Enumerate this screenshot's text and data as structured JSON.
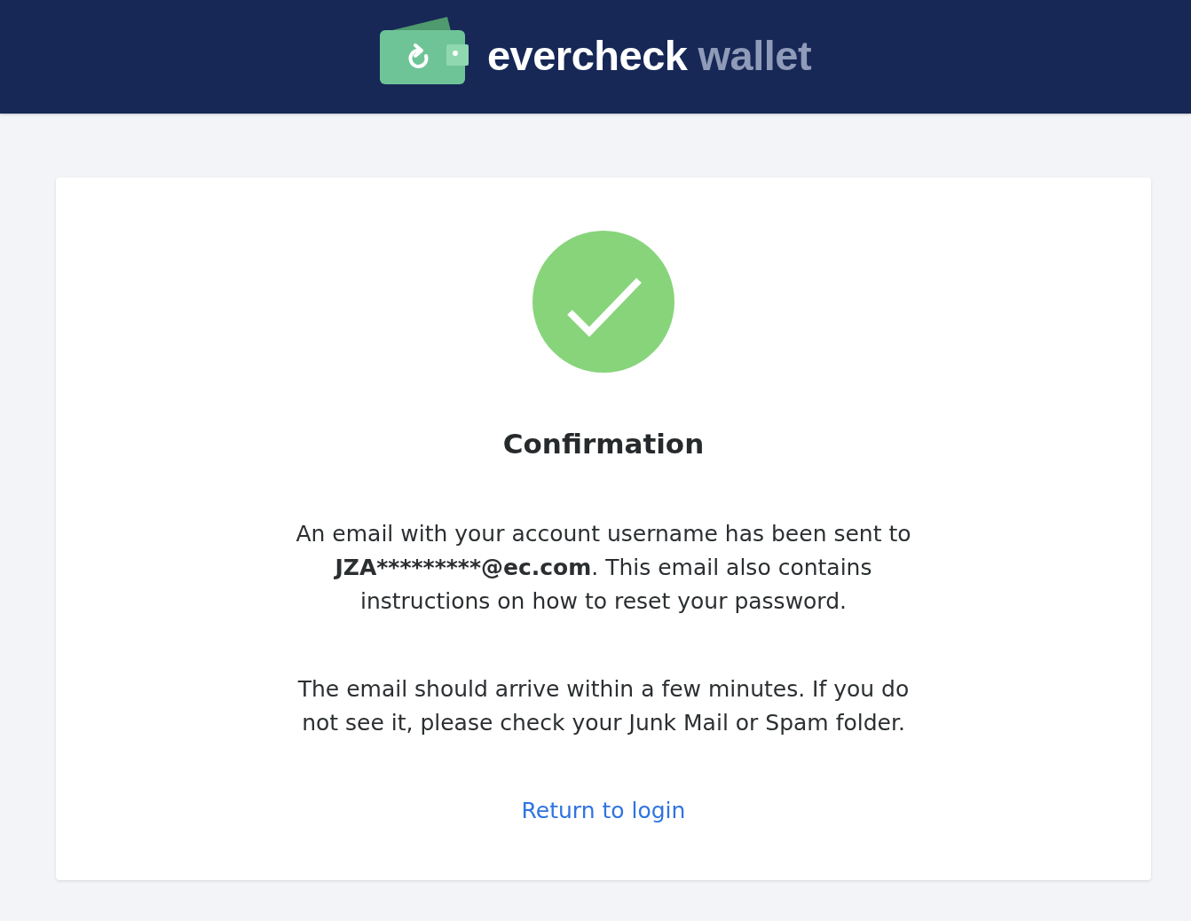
{
  "header": {
    "brand": "evercheck",
    "product": "wallet"
  },
  "confirmation": {
    "title": "Confirmation",
    "message": {
      "before": "An email with your account username has been sent to ",
      "email": "JZA*********@ec.com",
      "after": ". This email also contains instructions on how to reset your password."
    },
    "note": "The email should arrive within a few minutes. If you do not see it, please check your Junk Mail or Spam folder.",
    "link": "Return to login"
  }
}
